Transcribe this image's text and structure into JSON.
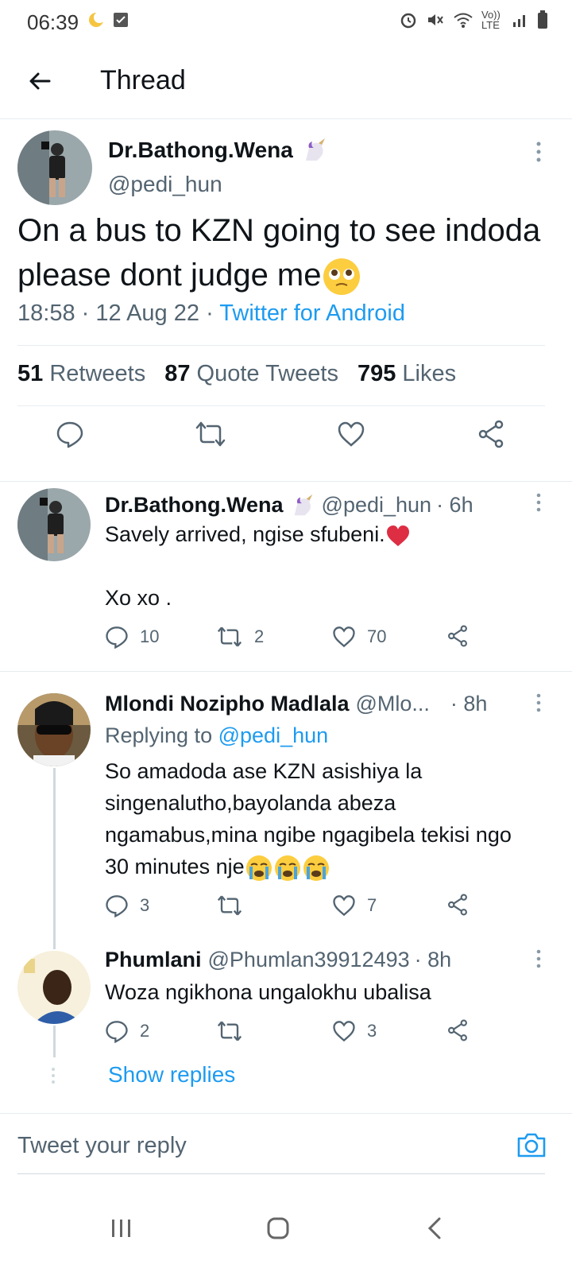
{
  "status_bar": {
    "time": "06:39",
    "network": "Vo)) LTE"
  },
  "header": {
    "title": "Thread"
  },
  "main_tweet": {
    "name": "Dr.Bathong.Wena",
    "handle": "@pedi_hun",
    "text": "On a bus to KZN going to see indoda please dont judge me",
    "time": "18:58",
    "date": "12 Aug 22",
    "source": "Twitter for Android",
    "retweets_count": "51",
    "retweets_label": "Retweets",
    "quotes_count": "87",
    "quotes_label": "Quote Tweets",
    "likes_count": "795",
    "likes_label": "Likes"
  },
  "replies": [
    {
      "name": "Dr.Bathong.Wena",
      "handle": "@pedi_hun",
      "time": "· 6h",
      "text_line1": "Savely arrived,  ngise sfubeni.",
      "text_line2": "Xo xo .",
      "reply_count": "10",
      "retweet_count": "2",
      "like_count": "70"
    },
    {
      "name": "Mlondi Nozipho Madlala",
      "handle": "@Mlo...",
      "time": "· 8h",
      "replying_prefix": "Replying to",
      "replying_to": "@pedi_hun",
      "text": "So amadoda ase KZN asishiya la singenalutho,bayolanda abeza ngamabus,mina ngibe ngagibela tekisi ngo 30 minutes nje",
      "reply_count": "3",
      "retweet_count": "",
      "like_count": "7"
    },
    {
      "name": "Phumlani",
      "handle": "@Phumlan39912493",
      "time": "· 8h",
      "text": "Woza ngikhona ungalokhu ubalisa",
      "reply_count": "2",
      "retweet_count": "",
      "like_count": "3"
    }
  ],
  "show_replies_label": "Show replies",
  "compose": {
    "placeholder": "Tweet your reply"
  },
  "colors": {
    "accent": "#1d9bf0",
    "secondary_text": "#536471",
    "divider": "#e6ecf0"
  }
}
